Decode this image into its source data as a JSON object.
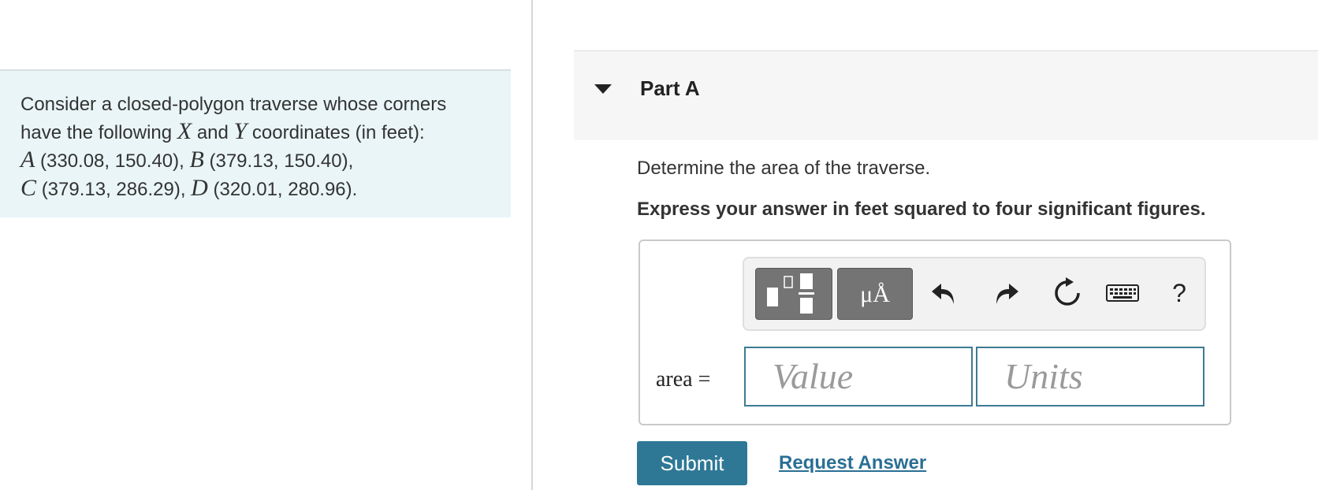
{
  "problem": {
    "line1": "Consider a closed-polygon traverse whose corners",
    "line2_pre": "have the following",
    "var_x": "X",
    "line2_and": "and",
    "var_y": "Y",
    "line2_post": "coordinates (in feet):",
    "pt_a": "A",
    "coord_a": "(330.08, 150.40),",
    "pt_b": "B",
    "coord_b": "(379.13, 150.40),",
    "pt_c": "C",
    "coord_c": "(379.13, 286.29),",
    "pt_d": "D",
    "coord_d": "(320.01, 280.96)."
  },
  "part": {
    "title": "Part A",
    "prompt": "Determine the area of the traverse.",
    "instruction": "Express your answer in feet squared to four significant figures."
  },
  "toolbar": {
    "units_label": "μÅ",
    "help_label": "?"
  },
  "answer": {
    "label": "area =",
    "value_placeholder": "Value",
    "units_placeholder": "Units"
  },
  "actions": {
    "submit_label": "Submit",
    "request_label": "Request Answer"
  },
  "icons": {
    "collapse": "caret-down-icon",
    "template": "fraction-template-icon",
    "undo": "undo-icon",
    "redo": "redo-icon",
    "reset": "reset-icon",
    "keyboard": "keyboard-icon",
    "help": "help-icon"
  },
  "colors": {
    "problem_bg": "#e9f5f7",
    "accent": "#2e7896",
    "link": "#2a6f95",
    "field_border": "#3e7a94"
  }
}
